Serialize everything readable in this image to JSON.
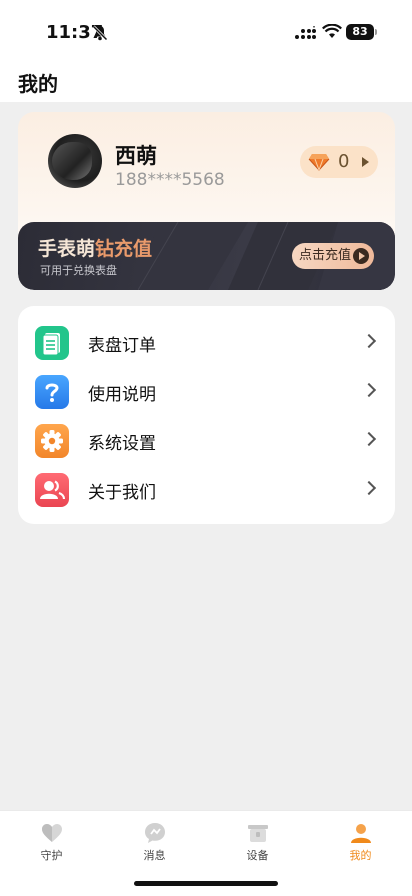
{
  "status_bar": {
    "time": "11:37",
    "battery": "83"
  },
  "header": {
    "title": "我的"
  },
  "profile": {
    "name": "西萌",
    "phone": "188****5568",
    "diamond_count": "0"
  },
  "banner": {
    "title_part1": "手表萌",
    "title_part2": "钻充值",
    "subtitle": "可用于兑换表盘",
    "button_label": "点击充值"
  },
  "menu": {
    "items": [
      {
        "label": "表盘订单",
        "icon": "document-icon",
        "color": "#22c58b"
      },
      {
        "label": "使用说明",
        "icon": "question-icon",
        "color": "#2e8cf0"
      },
      {
        "label": "系统设置",
        "icon": "gear-icon",
        "color": "#f5943a"
      },
      {
        "label": "关于我们",
        "icon": "users-icon",
        "color": "#f0525d"
      }
    ]
  },
  "tabs": [
    {
      "label": "守护",
      "icon": "heart-icon",
      "active": false
    },
    {
      "label": "消息",
      "icon": "message-icon",
      "active": false
    },
    {
      "label": "设备",
      "icon": "watch-icon",
      "active": false
    },
    {
      "label": "我的",
      "icon": "profile-icon",
      "active": true
    }
  ],
  "colors": {
    "accent": "#f08a1c",
    "banner_bg": "#2c2c36",
    "banner_accent": "#e99a6b"
  }
}
